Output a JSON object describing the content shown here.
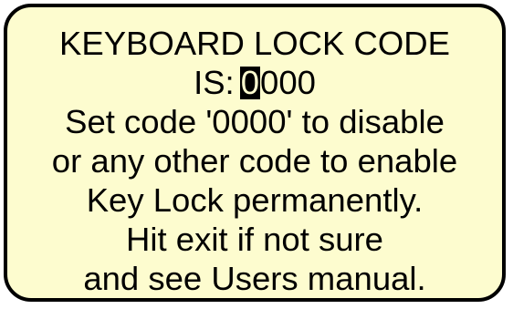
{
  "screen": {
    "title": "KEYBOARD LOCK CODE",
    "code_label": "IS:",
    "code_selected_digit": "0",
    "code_remaining_digits": "000",
    "line3": "Set code '0000' to disable",
    "line4": "or any other code to enable",
    "line5": "Key Lock permanently.",
    "line6": "Hit exit if not sure",
    "line7": "and see Users manual."
  },
  "colors": {
    "background": "#fdfccf",
    "border": "#000000",
    "text": "#000000",
    "cursor": "#000000"
  }
}
